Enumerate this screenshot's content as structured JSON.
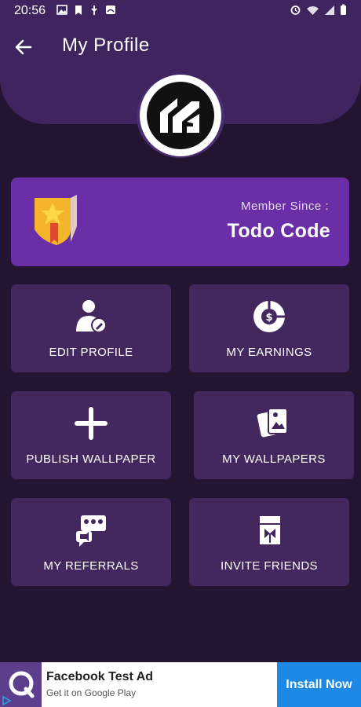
{
  "status_bar": {
    "time": "20:56",
    "icons_left": [
      "image-icon",
      "bookmark-icon",
      "usb-icon",
      "cast-icon"
    ],
    "icons_right": [
      "alarm-icon",
      "wifi-icon",
      "signal-icon",
      "battery-icon"
    ]
  },
  "header": {
    "title": "My Profile",
    "back_icon": "arrow-left-icon"
  },
  "member_card": {
    "label": "Member Since :",
    "name": "Todo Code",
    "badge_icon": "star-badge-icon"
  },
  "tiles": [
    {
      "label": "EDIT PROFILE",
      "icon": "edit-profile-icon"
    },
    {
      "label": "MY EARNINGS",
      "icon": "earnings-icon"
    },
    {
      "label": "PUBLISH WALLPAPER",
      "icon": "plus-icon"
    },
    {
      "label": "MY WALLPAPERS",
      "icon": "wallpapers-icon"
    },
    {
      "label": "MY REFERRALS",
      "icon": "referrals-icon"
    },
    {
      "label": "INVITE FRIENDS",
      "icon": "gift-icon"
    }
  ],
  "ad": {
    "title": "Facebook Test Ad",
    "subtitle": "Get it on Google Play",
    "cta": "Install Now"
  },
  "colors": {
    "background": "#231532",
    "header": "#3f2560",
    "card": "#6a2fa6",
    "tile": "#43275f",
    "ad_button": "#1e88e5"
  }
}
